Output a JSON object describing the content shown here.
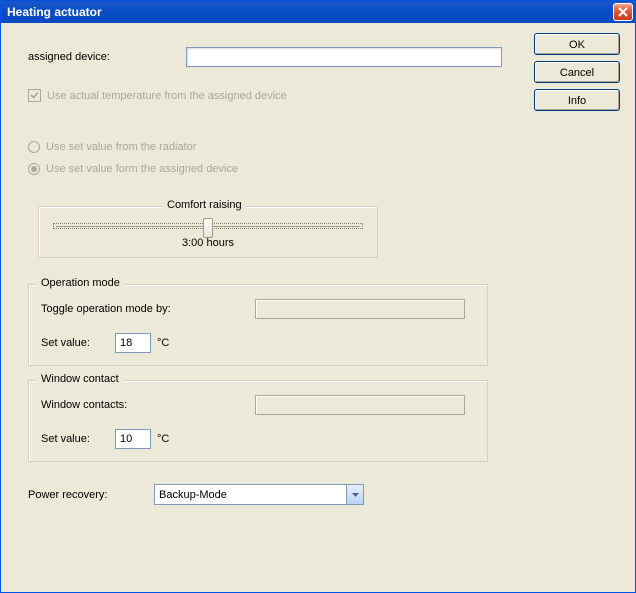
{
  "window": {
    "title": "Heating actuator"
  },
  "buttons": {
    "ok": "OK",
    "cancel": "Cancel",
    "info": "Info"
  },
  "assigned": {
    "label": "assigned device:",
    "value": ""
  },
  "checkbox_temp": {
    "label": "Use actual temperature from the assigned device",
    "checked": true
  },
  "radios": {
    "opt1": "Use set value from the radiator",
    "opt2": "Use set value form the assigned device",
    "selected": "opt2"
  },
  "comfort": {
    "legend": "Comfort raising",
    "readout": "3:00 hours"
  },
  "opmode": {
    "legend": "Operation mode",
    "toggle_label": "Toggle operation mode by:",
    "toggle_value": "",
    "set_label": "Set value:",
    "set_value": "18",
    "unit": "°C"
  },
  "wcontact": {
    "legend": "Window contact",
    "contacts_label": "Window contacts:",
    "contacts_value": "",
    "set_label": "Set value:",
    "set_value": "10",
    "unit": "°C"
  },
  "power": {
    "label": "Power recovery:",
    "selected": "Backup-Mode"
  }
}
